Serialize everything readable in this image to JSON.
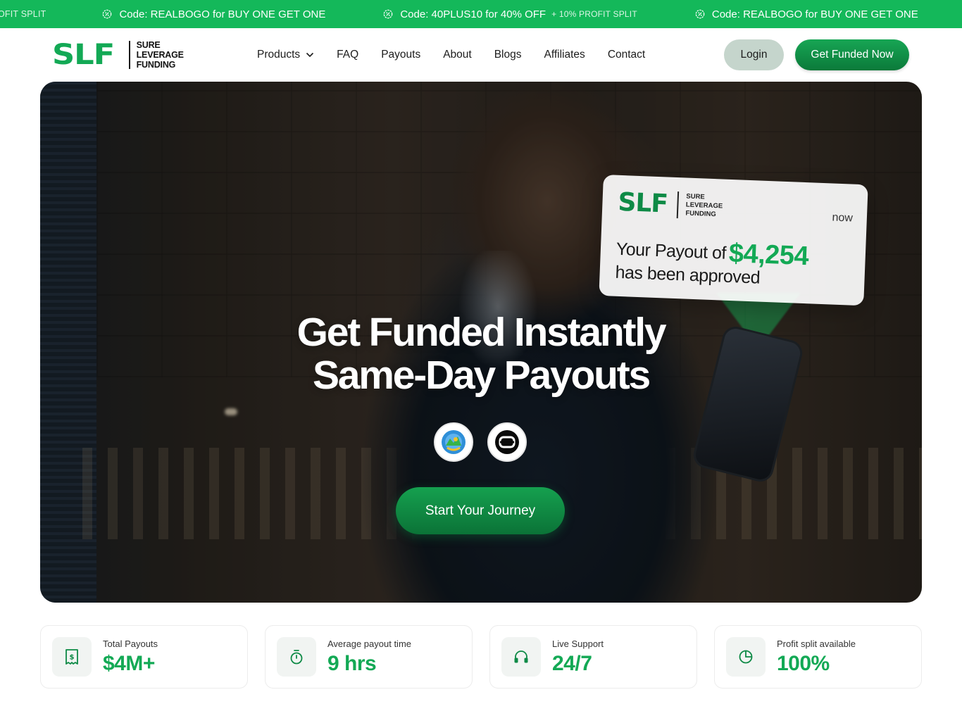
{
  "promo_bar": {
    "items": [
      {
        "text": "OFIT SPLIT",
        "sub": ""
      },
      {
        "text": "Code: REALBOGO for BUY ONE GET ONE",
        "sub": ""
      },
      {
        "text": "Code: 40PLUS10 for 40% OFF",
        "sub": "+ 10% PROFIT SPLIT"
      },
      {
        "text": "Code: REALBOGO for BUY ONE GET ONE",
        "sub": ""
      }
    ],
    "icon": "badge-percent-icon"
  },
  "header": {
    "logo": {
      "mark": "SLF",
      "words": [
        "SURE",
        "LEVERAGE",
        "FUNDING"
      ]
    },
    "nav": [
      {
        "label": "Products",
        "has_dropdown": true
      },
      {
        "label": "FAQ"
      },
      {
        "label": "Payouts"
      },
      {
        "label": "About"
      },
      {
        "label": "Blogs"
      },
      {
        "label": "Affiliates"
      },
      {
        "label": "Contact"
      }
    ],
    "login_label": "Login",
    "cta_label": "Get Funded Now"
  },
  "hero": {
    "title_line1": "Get Funded Instantly",
    "title_line2": "Same-Day Payouts",
    "platforms": [
      "metatrader-icon",
      "ctrader-icon"
    ],
    "cta_label": "Start Your Journey",
    "notification": {
      "logo_mark": "SLF",
      "logo_words": [
        "SURE",
        "LEVERAGE",
        "FUNDING"
      ],
      "time": "now",
      "line1_prefix": "Your Payout of",
      "amount": "$4,254",
      "line2": "has been approved"
    }
  },
  "stats": [
    {
      "label": "Total Payouts",
      "value": "$4M+",
      "icon": "receipt-dollar-icon"
    },
    {
      "label": "Average payout time",
      "value": "9 hrs",
      "icon": "stopwatch-icon"
    },
    {
      "label": "Live Support",
      "value": "24/7",
      "icon": "headphones-icon"
    },
    {
      "label": "Profit split available",
      "value": "100%",
      "icon": "pie-chart-icon"
    }
  ],
  "colors": {
    "brand": "#13a955",
    "promo_bg": "#14b85a",
    "login_bg": "#c5d5cc"
  }
}
